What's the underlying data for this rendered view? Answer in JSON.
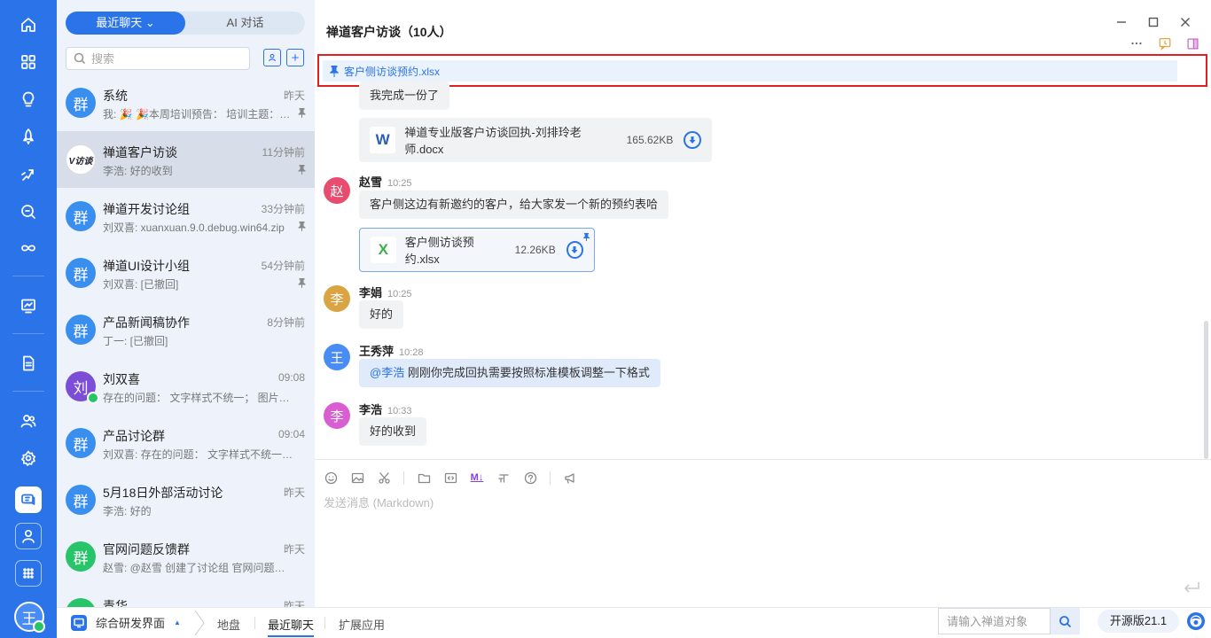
{
  "toggle": {
    "recent_label": "最近聊天 ⌄",
    "ai_label": "AI 对话"
  },
  "search": {
    "placeholder": "搜索"
  },
  "chats": [
    {
      "name": "系统",
      "time": "昨天",
      "preview": "我: 🎉 🎉本周培训预告： 培训主题：…",
      "avatar": "群",
      "pinned": true
    },
    {
      "name": "禅道客户访谈",
      "time": "11分钟前",
      "preview": "李浩: 好的收到",
      "avatar": "V访谈",
      "pinned": true,
      "selected": true
    },
    {
      "name": "禅道开发讨论组",
      "time": "33分钟前",
      "preview": "刘双喜: xuanxuan.9.0.debug.win64.zip",
      "avatar": "群",
      "pinned": true
    },
    {
      "name": "禅道UI设计小组",
      "time": "54分钟前",
      "preview": "刘双喜: [已撤回]",
      "avatar": "群",
      "pinned": true
    },
    {
      "name": "产品新闻稿协作",
      "time": "8分钟前",
      "preview": "丁一: [已撤回]",
      "avatar": "群"
    },
    {
      "name": "刘双喜",
      "time": "09:08",
      "preview": "存在的问题： 文字样式不统一； 图片大…",
      "avatar": "刘"
    },
    {
      "name": "产品讨论群",
      "time": "09:04",
      "preview": "刘双喜: 存在的问题： 文字样式不统一；…",
      "avatar": "群"
    },
    {
      "name": "5月18日外部活动讨论",
      "time": "昨天",
      "preview": "李浩: 好的",
      "avatar": "群"
    },
    {
      "name": "官网问题反馈群",
      "time": "昨天",
      "preview": "赵雪: @赵雪 创建了讨论组 官网问题反…",
      "avatar": "群"
    },
    {
      "name": "青华",
      "time": "昨天",
      "preview": "",
      "avatar": "群"
    }
  ],
  "chat": {
    "title": "禅道客户访谈（10人）",
    "pinned_file": "客户侧访谈预约.xlsx",
    "messages": {
      "m1_text": "我完成一份了",
      "m1_file_name": "禅道专业版客户访谈回执-刘排玲老师.docx",
      "m1_file_size": "165.62KB",
      "m1_file_icon": "W",
      "m2_sender": "赵雪",
      "m2_time": "10:25",
      "m2_avatar": "赵",
      "m2_text": "客户侧这边有新邀约的客户，给大家发一个新的预约表哈",
      "m2_file_name": "客户侧访谈预约.xlsx",
      "m2_file_size": "12.26KB",
      "m2_file_icon": "X",
      "m3_sender": "李娟",
      "m3_time": "10:25",
      "m3_avatar": "李",
      "m3_text": "好的",
      "m4_sender": "王秀萍",
      "m4_time": "10:28",
      "m4_avatar": "王",
      "m4_mention": "@李浩",
      "m4_text": " 刚刚你完成回执需要按照标准模板调整一下格式",
      "m5_sender": "李浩",
      "m5_time": "10:33",
      "m5_avatar": "李",
      "m5_text": "好的收到"
    },
    "editor_placeholder": "发送消息 (Markdown)",
    "markdown_label": "M↓"
  },
  "bottom": {
    "app_label": "综合研发界面",
    "caret": "▲",
    "tabs": [
      "地盘",
      "最近聊天",
      "扩展应用"
    ],
    "search_placeholder": "请输入禅道对象",
    "version": "开源版21.1"
  },
  "rail_user_avatar": "王",
  "colors": {
    "accent": "#2a73e8",
    "highlight_border": "#e02020",
    "online": "#27c46a"
  }
}
